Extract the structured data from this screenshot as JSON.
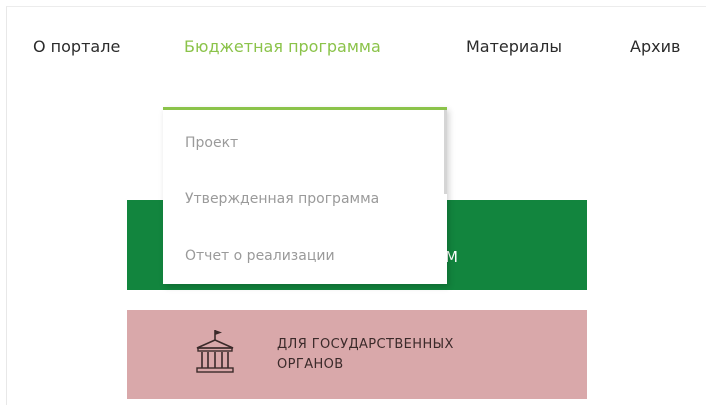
{
  "nav": {
    "items": [
      {
        "label": "О портале"
      },
      {
        "label": "Бюджетная программа"
      },
      {
        "label": "Материалы"
      },
      {
        "label": "Архив"
      }
    ],
    "active_color": "#8bc34a"
  },
  "dropdown": {
    "items": [
      {
        "label": "Проект"
      },
      {
        "label": "Утвержденная программа"
      },
      {
        "label": "Отчет о реализации"
      }
    ]
  },
  "banners": {
    "green": {
      "visible_text": "М",
      "color": "#12853e"
    },
    "pink": {
      "line1": "ДЛЯ ГОСУДАРСТВЕННЫХ",
      "line2": "ОРГАНОВ",
      "icon": "government-building-icon",
      "color": "#d9a8aa"
    }
  }
}
